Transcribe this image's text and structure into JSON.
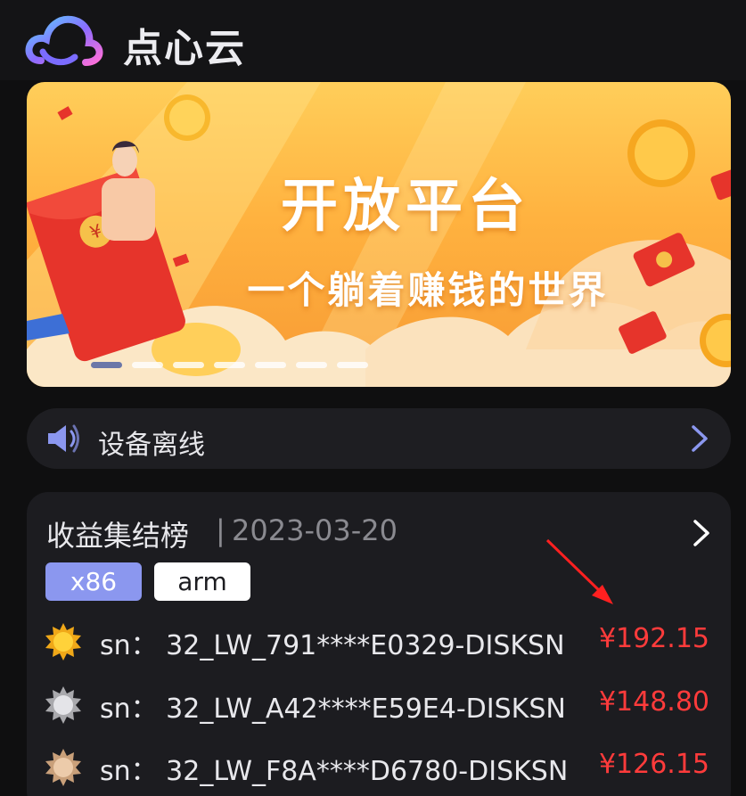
{
  "app": {
    "title": "点心云"
  },
  "banner": {
    "title": "开放平台",
    "subtitle": "一个躺着赚钱的世界",
    "dot_count": 7,
    "active_dot": 0,
    "colors": {
      "top": "#ffce5a",
      "bottom": "#f79a34"
    }
  },
  "notice": {
    "text": "设备离线",
    "icon": "speaker-icon"
  },
  "ranking": {
    "title": "收益集结榜",
    "separator": "|",
    "date": "2023-03-20",
    "chips": [
      {
        "label": "x86",
        "selected": true
      },
      {
        "label": "arm",
        "selected": false
      }
    ],
    "rows": [
      {
        "medal": "gold-medal-icon",
        "sn": "sn：  32_LW_791****E0329-DISKSN",
        "amount": "¥192.15"
      },
      {
        "medal": "silver-medal-icon",
        "sn": "sn：  32_LW_A42****E59E4-DISKSN",
        "amount": "¥148.80"
      },
      {
        "medal": "bronze-medal-icon",
        "sn": "sn：  32_LW_F8A****D6780-DISKSN",
        "amount": "¥126.15"
      }
    ],
    "amount_color": "#ff3b3b"
  }
}
